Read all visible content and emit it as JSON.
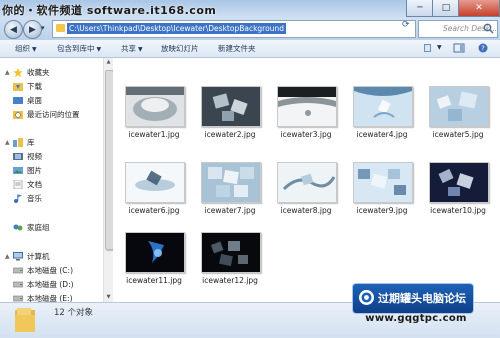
{
  "watermark": {
    "site_text": "你的・软件频道 software.it168.com",
    "forum_name": "过期罐头电脑论坛",
    "forum_url": "www.gqgtpc.com"
  },
  "window_controls": {
    "minimize": "─",
    "maximize": "□",
    "close": "✕"
  },
  "address": {
    "path": "C:\\Users\\Thinkpad\\Desktop\\Icewater\\DesktopBackground",
    "search_placeholder": "Search Desk..."
  },
  "toolbar": {
    "organize": "组织",
    "include_in_library": "包含到库中",
    "share": "共享",
    "slideshow": "放映幻灯片",
    "new_folder": "新建文件夹"
  },
  "nav": {
    "favorites": "收藏夹",
    "downloads": "下载",
    "desktop": "桌面",
    "recent": "最近访问的位置",
    "libraries": "库",
    "videos": "视频",
    "pictures": "图片",
    "documents": "文档",
    "music": "音乐",
    "homegroup": "家庭组",
    "computer": "计算机",
    "drive_c": "本地磁盘 (C:)",
    "drive_d": "本地磁盘 (D:)",
    "drive_e": "本地磁盘 (E:)"
  },
  "files": [
    {
      "name": "icewater1.jpg"
    },
    {
      "name": "icewater2.jpg"
    },
    {
      "name": "icewater3.jpg"
    },
    {
      "name": "icewater4.jpg"
    },
    {
      "name": "icewater5.jpg"
    },
    {
      "name": "icewater6.jpg"
    },
    {
      "name": "icewater7.jpg"
    },
    {
      "name": "icewater8.jpg"
    },
    {
      "name": "icewater9.jpg"
    },
    {
      "name": "icewater10.jpg"
    },
    {
      "name": "icewater11.jpg"
    },
    {
      "name": "icewater12.jpg"
    }
  ],
  "status": {
    "item_count": "12 个对象"
  },
  "colors": {
    "accent": "#3d73c6",
    "folder": "#f1c64c"
  }
}
